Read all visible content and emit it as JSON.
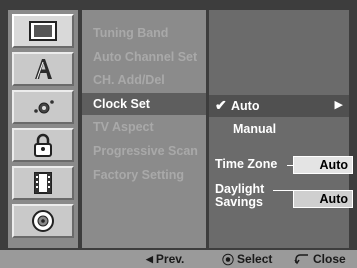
{
  "icons": [
    {
      "name": "tv-display-icon",
      "active": true
    },
    {
      "name": "language-icon",
      "active": false
    },
    {
      "name": "audio-icon",
      "active": false
    },
    {
      "name": "lock-icon",
      "active": false
    },
    {
      "name": "film-record-icon",
      "active": false
    },
    {
      "name": "disc-icon",
      "active": false
    }
  ],
  "menu": {
    "items": [
      "Tuning Band",
      "Auto Channel Set",
      "CH. Add/Del",
      "Clock Set",
      "TV Aspect",
      "Progressive Scan",
      "Factory Setting"
    ],
    "selected": "Clock Set"
  },
  "clock": {
    "auto_label": "Auto",
    "manual_label": "Manual",
    "timezone_label": "Time Zone",
    "timezone_value": "Auto",
    "daylight_label_line1": "Daylight",
    "daylight_label_line2": "Savings",
    "daylight_value": "Auto"
  },
  "footer": {
    "prev_label": "Prev.",
    "select_label": "Select",
    "close_label": "Close"
  },
  "colors": {
    "selected_bg": "#5e5e5e",
    "inactive_text": "#a9a9a9",
    "active_text": "#ffffff"
  }
}
